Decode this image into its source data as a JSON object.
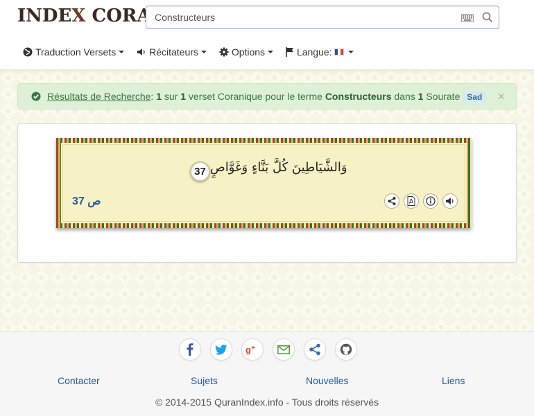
{
  "header": {
    "logo_part1": "INDE",
    "logo_x": "X",
    "logo_part2": " CORAN",
    "search": {
      "value": "Constructeurs",
      "placeholder": ""
    }
  },
  "nav": {
    "items": [
      {
        "label": "Traduction Versets",
        "icon": "globe-icon"
      },
      {
        "label": "Récitateurs",
        "icon": "volume-icon"
      },
      {
        "label": "Options",
        "icon": "gear-icon"
      },
      {
        "label": "Langue:",
        "icon": "flag-icon"
      }
    ]
  },
  "alert": {
    "link_text": "Résultats de Recherche",
    "colon": ":",
    "count": "1",
    "sur": "sur",
    "total": "1",
    "verse_phrase": "verset Coranique pour le terme",
    "term": "Constructeurs",
    "dans": "dans",
    "sourate_count": "1",
    "sourate_word": "Sourate",
    "sourate_badge": "Sad",
    "close": "×"
  },
  "verse": {
    "arabic": "وَالشَّيَاطِينَ كُلَّ بَنَّاءٍ وَغَوَّاصٍ",
    "number": "37",
    "reference": "ص 37",
    "buttons": [
      "share-icon",
      "pdf-icon",
      "info-icon",
      "audio-icon"
    ]
  },
  "footer": {
    "social": [
      "facebook-icon",
      "twitter-icon",
      "google-plus-icon",
      "email-icon",
      "share-icon",
      "github-icon"
    ],
    "links": [
      "Contacter",
      "Sujets",
      "Nouvelles",
      "Liens"
    ],
    "copyright": "© 2014-2015 QuranIndex.info - Tous droits réservés"
  },
  "colors": {
    "alert_bg": "#dff0d8",
    "alert_text": "#3c763d",
    "link": "#2a5a9e",
    "verse_bg": "#f7f2c6",
    "facebook": "#3b5998",
    "twitter": "#1da1f2",
    "google_plus": "#d34836",
    "email": "#5a9e3e",
    "share": "#3b6ea5",
    "github": "#555555"
  }
}
